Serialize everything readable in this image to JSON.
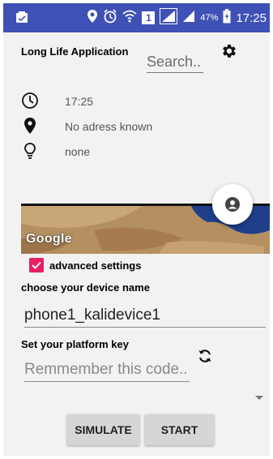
{
  "status_bar": {
    "battery": "47%",
    "time": "17:25",
    "sim_label": "1",
    "icons": [
      "notification-icon",
      "location-icon",
      "alarm-icon",
      "wifi-icon",
      "sim-icon",
      "signal-icon",
      "signal-icon",
      "battery-icon"
    ]
  },
  "header": {
    "title": "Long Life Application",
    "search_placeholder": "Search..",
    "settings_icon": "gear-icon"
  },
  "info": {
    "time": "17:25",
    "address": "No adress known",
    "idea": "none"
  },
  "map": {
    "logo_text": "Google"
  },
  "advanced": {
    "checked": true,
    "label": "advanced settings"
  },
  "device": {
    "label": "choose your device name",
    "value": "phone1_kalidevice1"
  },
  "platform": {
    "label": "Set your platform key",
    "placeholder": "Remmember this code.."
  },
  "buttons": {
    "simulate": "SIMULATE",
    "start": "START"
  },
  "colors": {
    "status_bar": "#3f51b5",
    "checkbox": "#e91e63",
    "background": "#f2f2f2"
  }
}
